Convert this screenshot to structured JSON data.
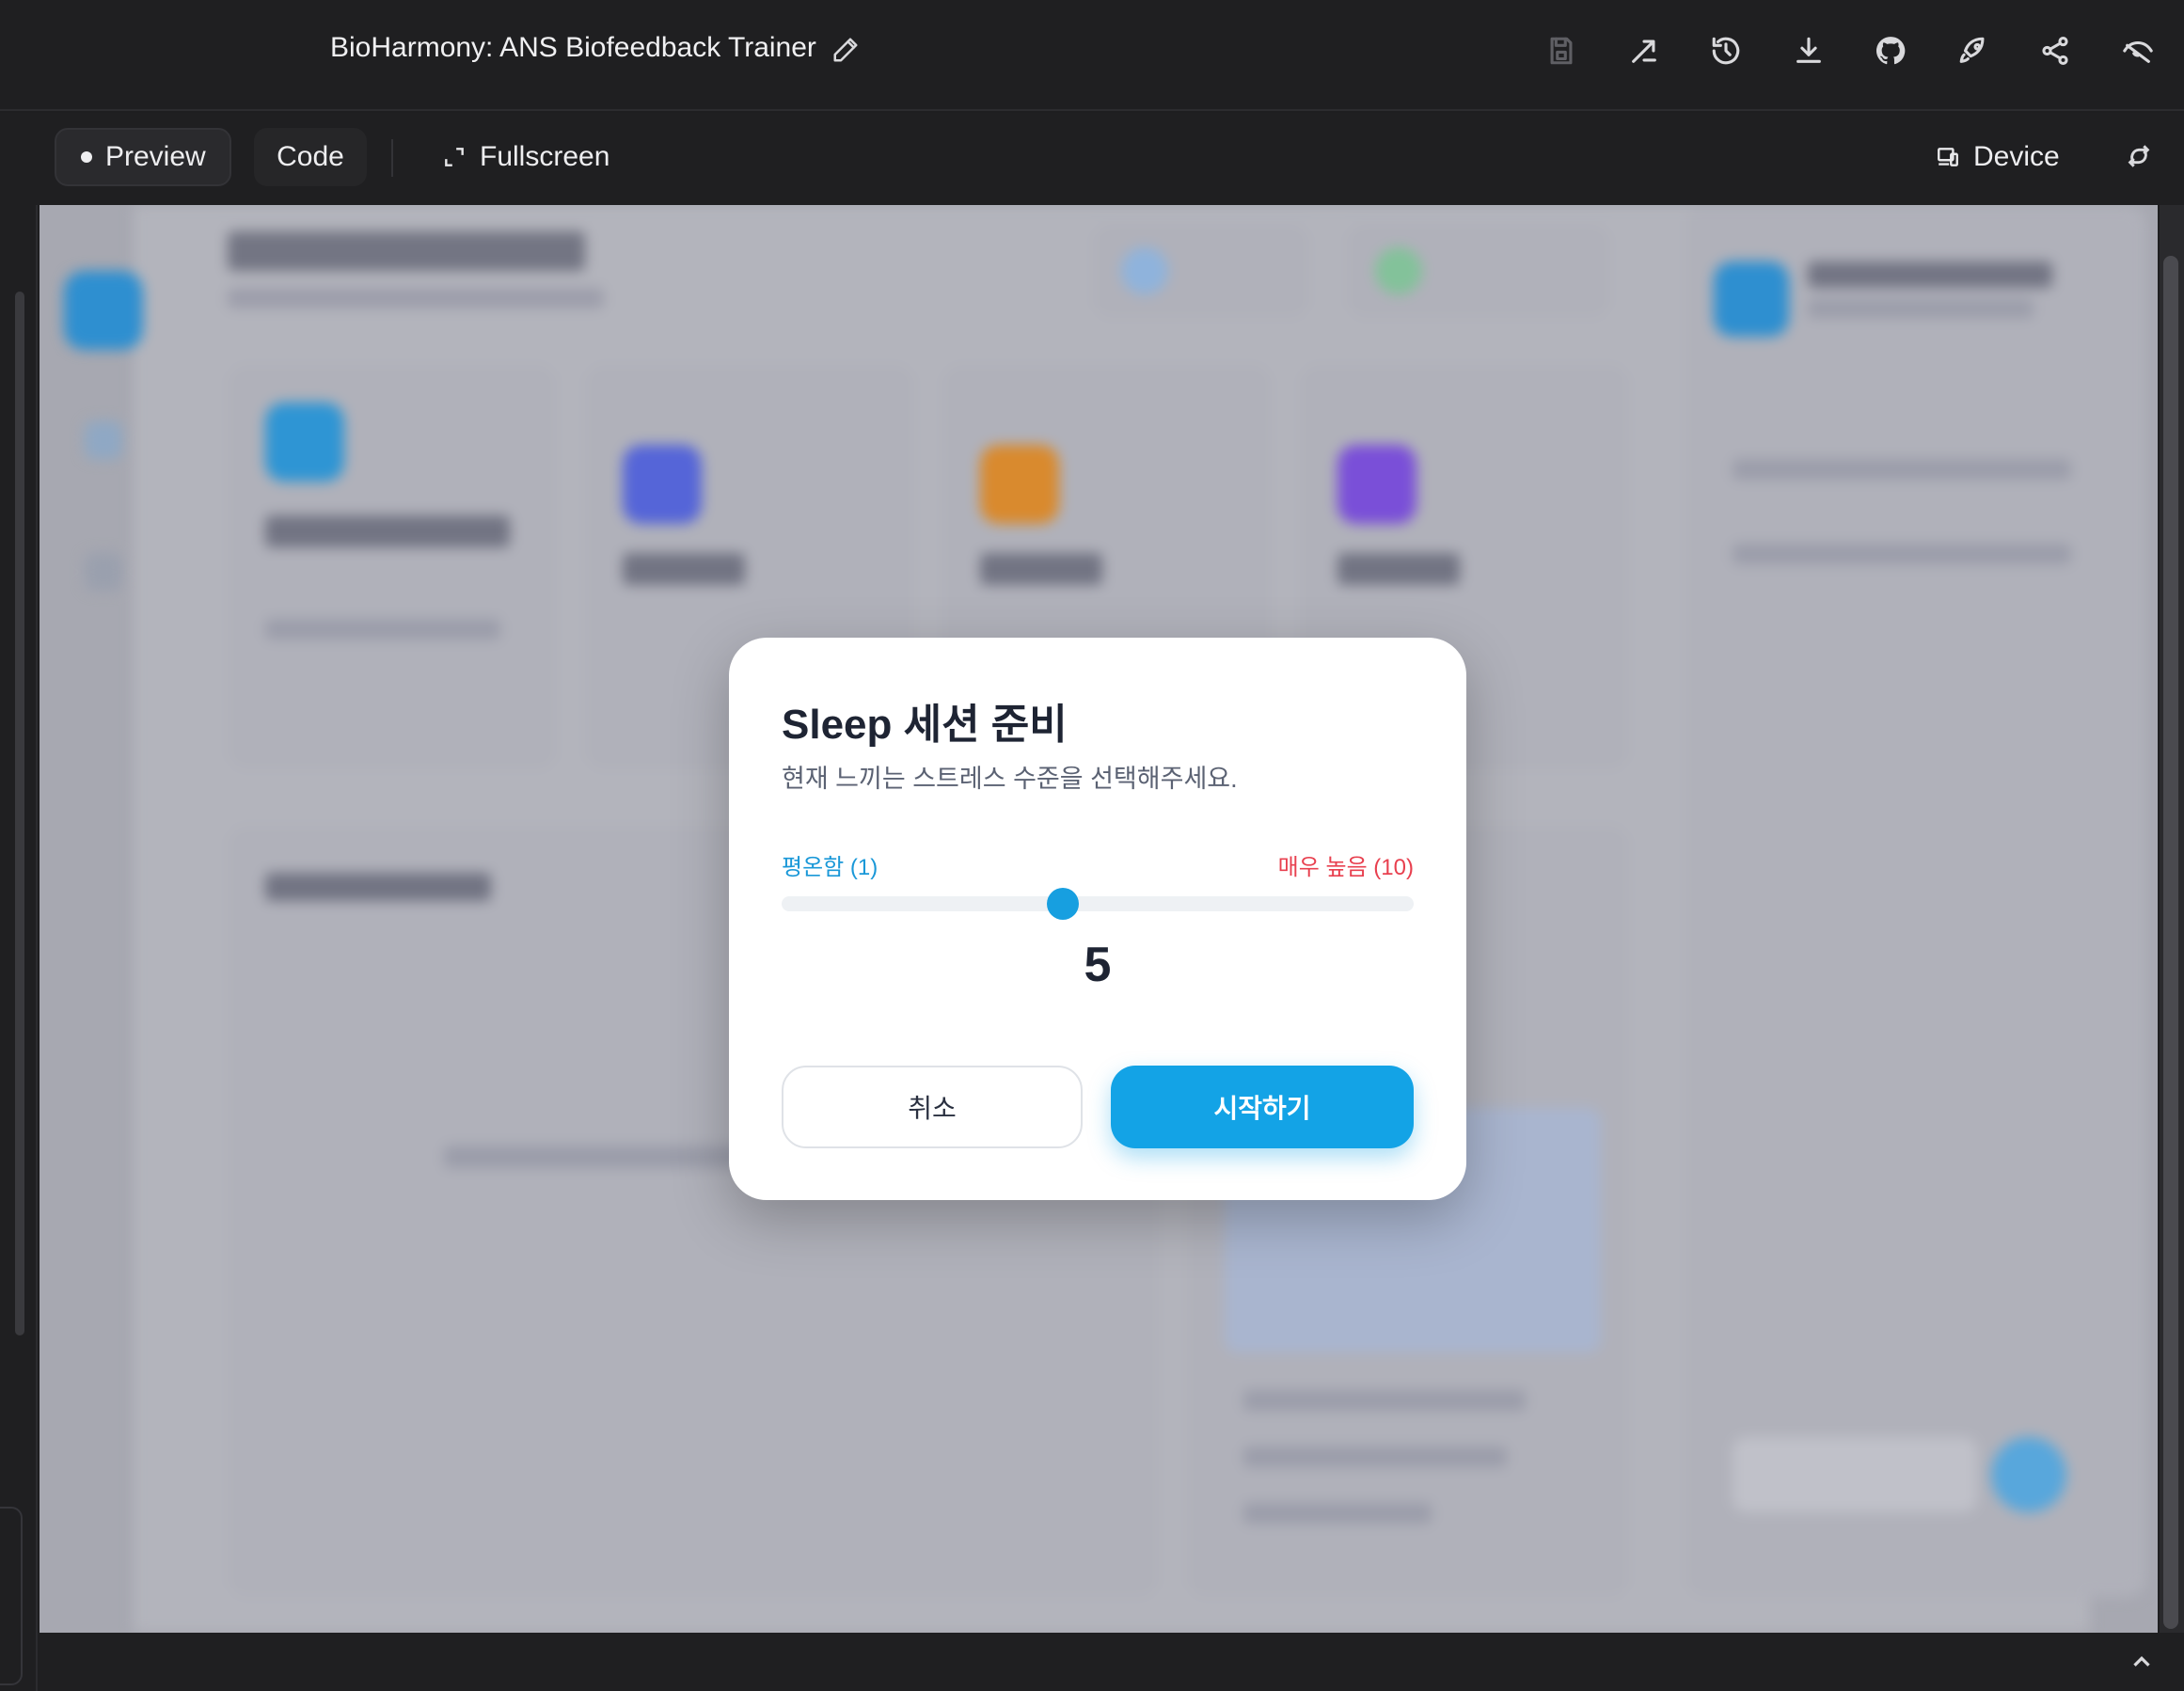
{
  "header": {
    "title": "BioHarmony: ANS Biofeedback Trainer",
    "icons": [
      "pencil-icon",
      "save-icon",
      "fork-icon",
      "history-icon",
      "download-icon",
      "github-icon",
      "deploy-rocket-icon",
      "share-icon",
      "hide-eye-icon"
    ]
  },
  "toolbar": {
    "preview_label": "Preview",
    "code_label": "Code",
    "fullscreen_label": "Fullscreen",
    "device_label": "Device"
  },
  "modal": {
    "title": "Sleep 세션 준비",
    "subtitle": "현재 느끼는 스트레스 수준을 선택해주세요.",
    "scale_low_label": "평온함 (1)",
    "scale_high_label": "매우 높음 (10)",
    "stress_min": 1,
    "stress_max": 10,
    "stress_value": 5,
    "stress_value_text": "5",
    "cancel_label": "취소",
    "start_label": "시작하기"
  },
  "colors": {
    "accent": "#13a3e6",
    "high_label": "#e8404f",
    "low_label": "#1a98d8",
    "overlay": "#a7a8b1",
    "chrome": "#1f1f21"
  }
}
